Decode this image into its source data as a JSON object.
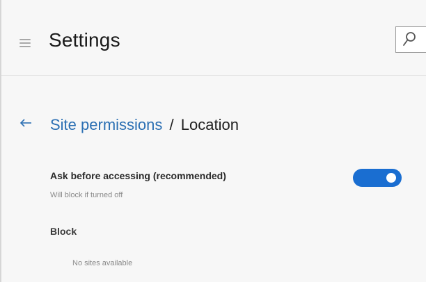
{
  "header": {
    "title": "Settings",
    "menu_icon": "hamburger-menu-icon",
    "search_icon": "search-icon"
  },
  "breadcrumb": {
    "back_icon": "back-arrow-icon",
    "parent": "Site permissions",
    "separator": "/",
    "current": "Location"
  },
  "location_setting": {
    "label": "Ask before accessing (recommended)",
    "description": "Will block if turned off",
    "enabled": true
  },
  "block_section": {
    "heading": "Block",
    "empty_text": "No sites available"
  },
  "colors": {
    "accent": "#1a6ed1",
    "link": "#2b6fb3",
    "background": "#f7f7f7"
  }
}
